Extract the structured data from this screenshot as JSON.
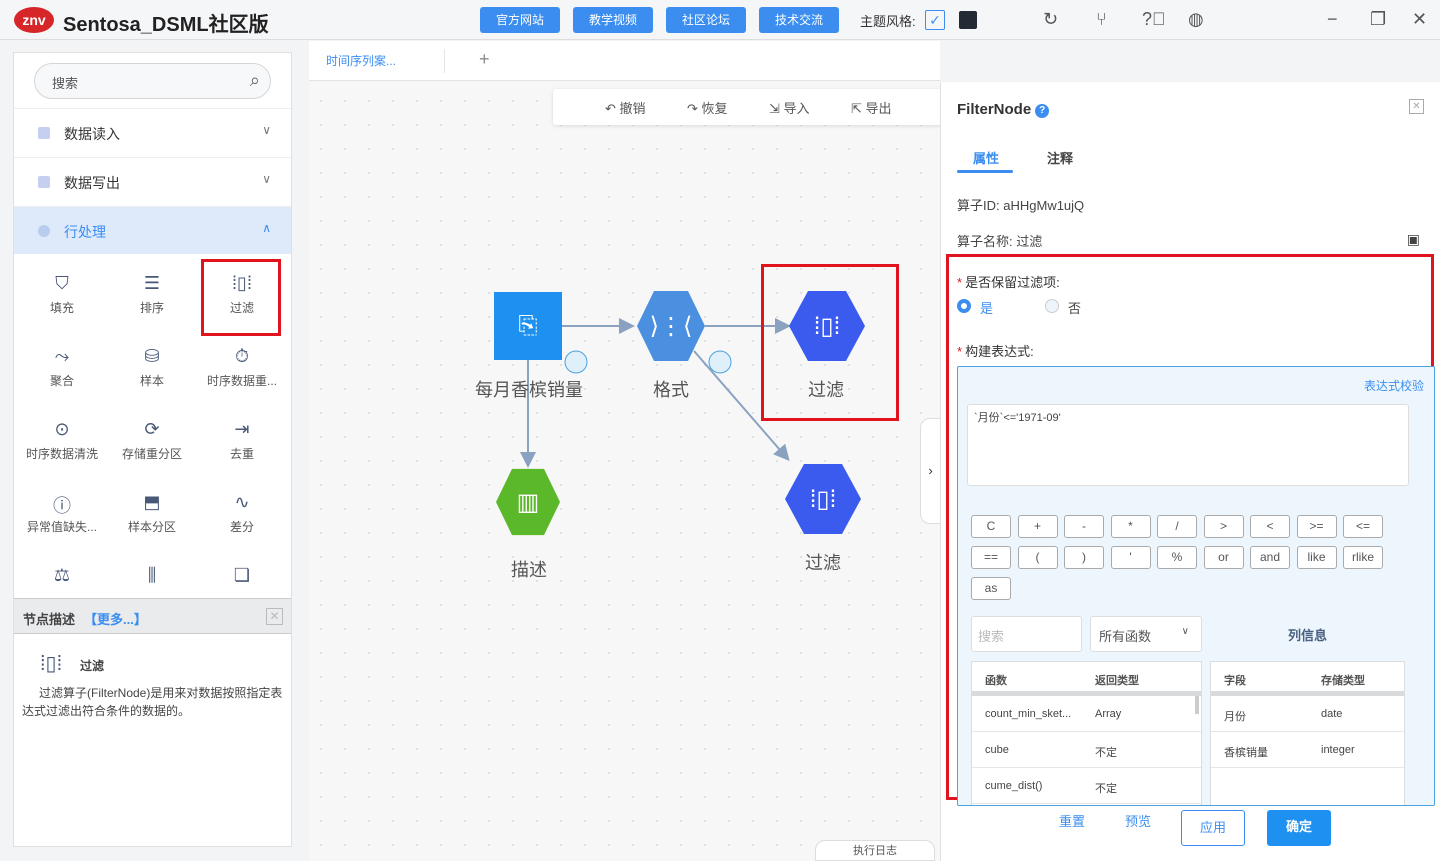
{
  "app": {
    "logo": "znv",
    "title": "Sentosa_DSML社区版",
    "links": [
      "官方网站",
      "教学视频",
      "社区论坛",
      "技术交流"
    ],
    "theme_label": "主题风格:",
    "theme_checked": true,
    "icons": [
      "refresh-icon",
      "branch-icon",
      "help-icon",
      "globe-icon",
      "minimize-icon",
      "restore-icon",
      "close-icon"
    ]
  },
  "sidebar": {
    "search_placeholder": "搜索",
    "categories": [
      {
        "label": "数据读入",
        "expanded": false
      },
      {
        "label": "数据写出",
        "expanded": false
      },
      {
        "label": "行处理",
        "expanded": true
      }
    ],
    "tools": [
      "填充",
      "排序",
      "过滤",
      "聚合",
      "样本",
      "时序数据重...",
      "时序数据清洗",
      "存储重分区",
      "去重",
      "异常值缺失...",
      "样本分区",
      "差分"
    ],
    "description": {
      "header": "节点描述",
      "more": "【更多...】",
      "node_name": "过滤",
      "text": "过滤算子(FilterNode)是用来对数据按照指定表达式过滤出符合条件的数据的。"
    }
  },
  "canvas": {
    "tab": "时间序列案...",
    "toolbar": [
      "撤销",
      "恢复",
      "导入",
      "导出"
    ],
    "nodes": [
      {
        "label": "每月香槟销量",
        "color": "#1e90f0"
      },
      {
        "label": "格式",
        "color": "#4a8fe0"
      },
      {
        "label": "过滤",
        "color": "#3b5bef"
      },
      {
        "label": "描述",
        "color": "#5cb82b"
      },
      {
        "label": "过滤",
        "color": "#3b5bef"
      }
    ],
    "log_tab": "执行日志"
  },
  "panel": {
    "title": "FilterNode",
    "tabs": [
      "属性",
      "注释"
    ],
    "active_tab": "属性",
    "id_label": "算子ID:",
    "id_value": "aHHgMw1ujQ",
    "name_label": "算子名称:",
    "name_value": "过滤",
    "keep_label": "是否保留过滤项:",
    "keep_options": [
      "是",
      "否"
    ],
    "keep_selected": "是",
    "expr_label": "构建表达式:",
    "validate": "表达式校验",
    "expression": "`月份`<='1971-09'",
    "operators": [
      "C",
      "+",
      "-",
      "*",
      "/",
      ">",
      "<",
      ">=",
      "<=",
      "==",
      "(",
      ")",
      "'",
      "%",
      "or",
      "and",
      "like",
      "rlike",
      "as"
    ],
    "func_search_placeholder": "搜索",
    "func_select": "所有函数",
    "column_info": "列信息",
    "func_headers": [
      "函数",
      "返回类型"
    ],
    "functions": [
      [
        "count_min_sket...",
        "Array"
      ],
      [
        "cube",
        "不定"
      ],
      [
        "cume_dist()",
        "不定"
      ]
    ],
    "col_headers": [
      "字段",
      "存储类型"
    ],
    "columns": [
      [
        "月份",
        "date"
      ],
      [
        "香槟销量",
        "integer"
      ]
    ],
    "buttons": {
      "reset": "重置",
      "preview": "预览",
      "apply": "应用",
      "ok": "确定"
    }
  },
  "colors": {
    "accent": "#3b8ef0",
    "highlight": "#e0141e"
  }
}
